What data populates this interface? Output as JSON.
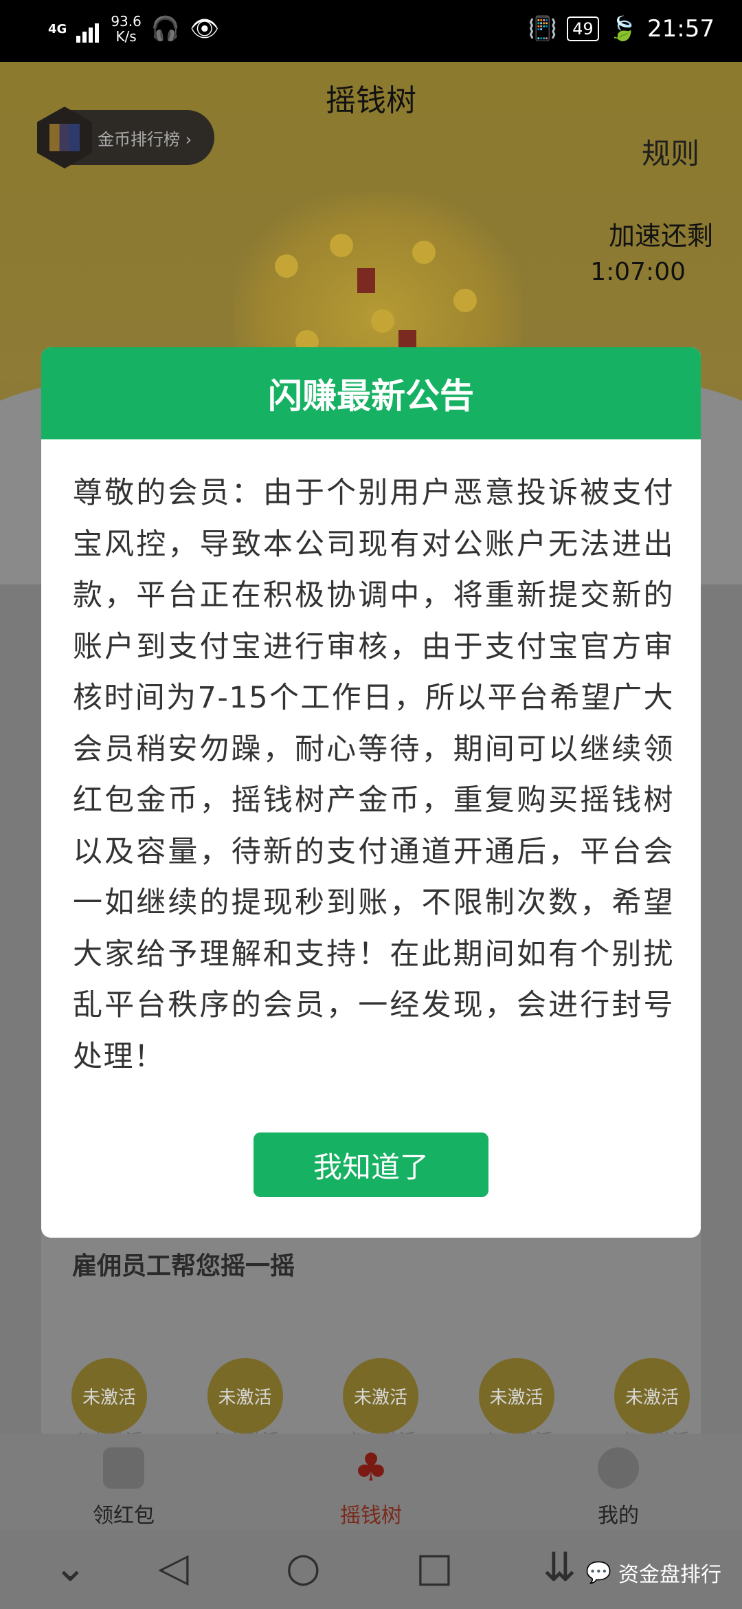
{
  "status_bar": {
    "network": "4G",
    "speed_value": "93.6",
    "speed_unit": "K/s",
    "battery": "49",
    "time": "21:57"
  },
  "header": {
    "title": "摇钱树",
    "rank_label": "金币排行榜 ›",
    "rules_label": "规则",
    "accel_label": "加速还剩",
    "accel_time": "1:07:00"
  },
  "dialog": {
    "title": "闪赚最新公告",
    "body": "尊敬的会员：由于个别用户恶意投诉被支付宝风控，导致本公司现有对公账户无法进出款，平台正在积极协调中，将重新提交新的账户到支付宝进行审核，由于支付宝官方审核时间为7-15个工作日，所以平台希望广大会员稍安勿躁，耐心等待，期间可以继续领红包金币，摇钱树产金币，重复购买摇钱树以及容量，待新的支付通道开通后，平台会一如继续的提现秒到账，不限制次数，希望大家给予理解和支持！在此期间如有个别扰乱平台秩序的会员，一经发现，会进行封号处理！",
    "confirm_label": "我知道了"
  },
  "employees": {
    "title": "雇佣员工帮您摇一摇",
    "slots": [
      "未激活",
      "未激活",
      "未激活",
      "未激活",
      "未激活"
    ],
    "slot_sub": [
      "点击激活",
      "点击激活",
      "点击激活",
      "点击激活",
      "点击激活"
    ]
  },
  "bottom_nav": [
    {
      "label": "领红包",
      "icon": "red-envelope-icon"
    },
    {
      "label": "摇钱树",
      "icon": "money-tree-icon"
    },
    {
      "label": "我的",
      "icon": "profile-icon"
    }
  ],
  "watermark": "资金盘排行",
  "colors": {
    "accent_green": "#16b162",
    "status_bar_bg": "#000000",
    "overlay_gray": "#7a7a7a"
  }
}
